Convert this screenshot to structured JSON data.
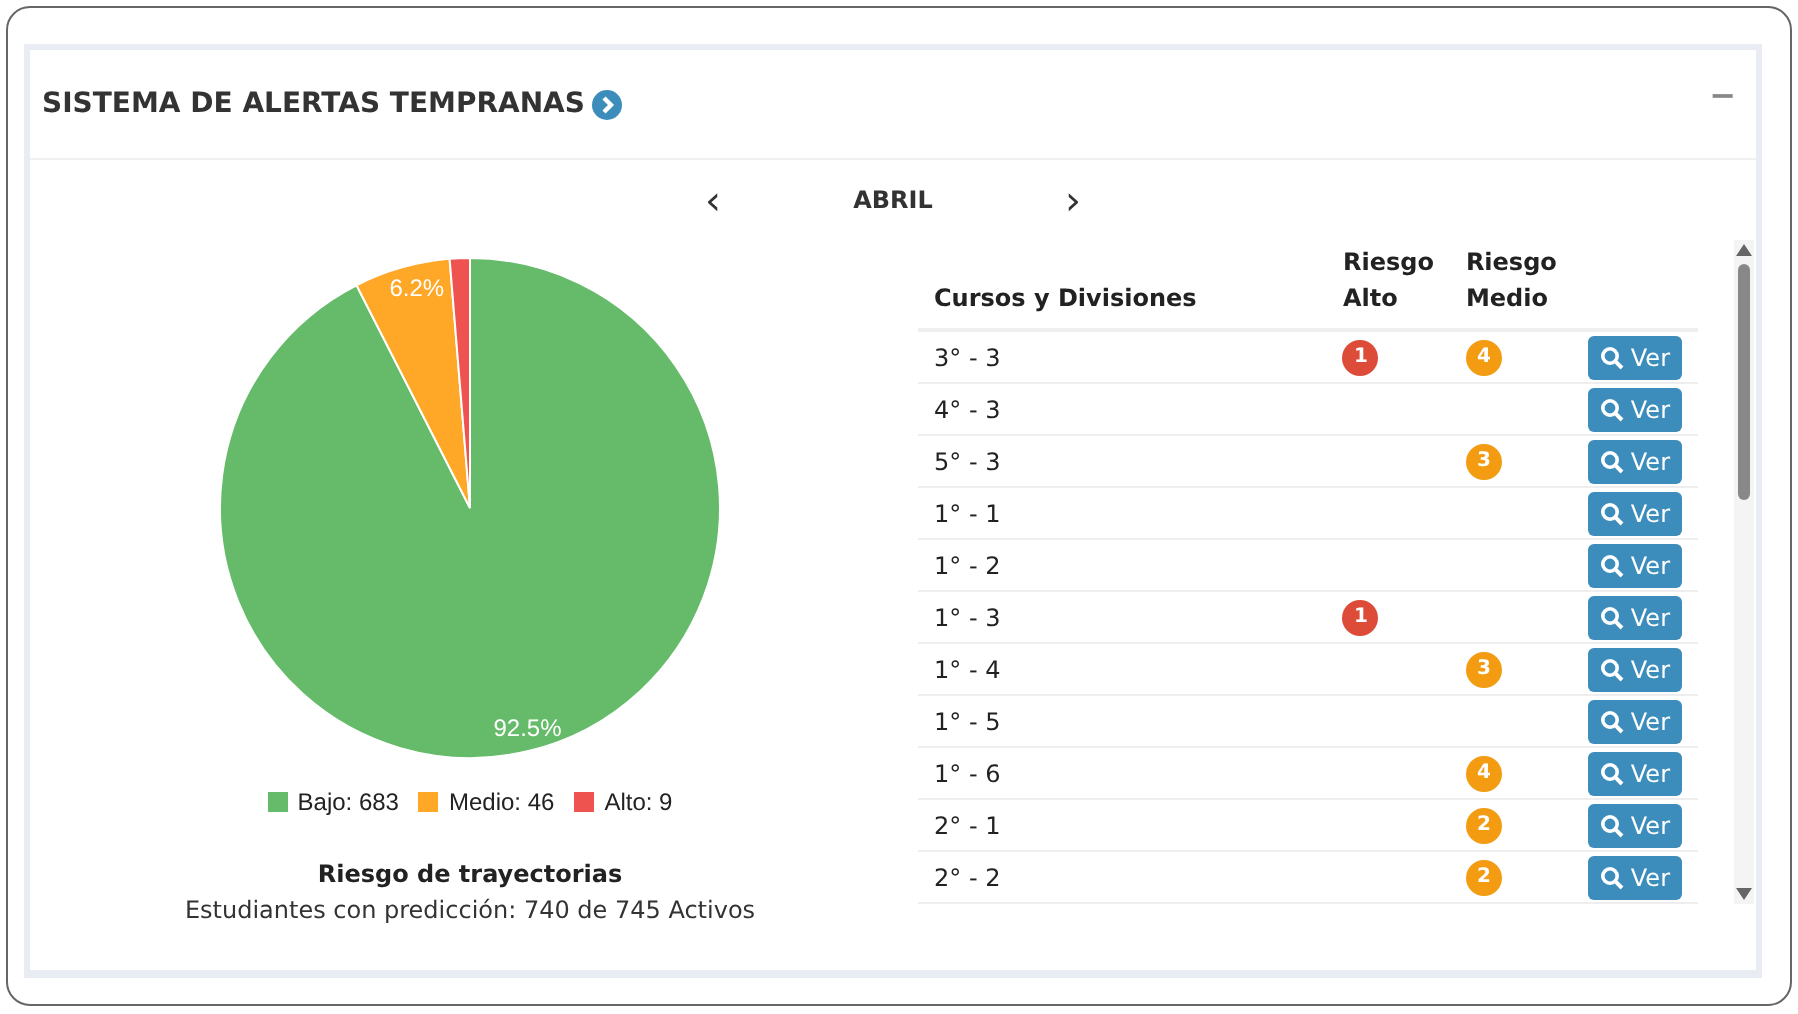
{
  "card": {
    "title": "SISTEMA DE ALERTAS TEMPRANAS",
    "collapse_symbol": "−"
  },
  "month_nav": {
    "prev": "‹",
    "month": "ABRIL",
    "next": "›"
  },
  "chart": {
    "chart_data": {
      "type": "pie",
      "categories": [
        "Bajo: 683",
        "Medio: 46",
        "Alto: 9"
      ],
      "values": [
        92.5,
        6.2,
        1.3
      ],
      "colors": [
        "#66bb6a",
        "#ffa726",
        "#ef5350"
      ],
      "value_labels": [
        "92.5%",
        "6.2%",
        null
      ]
    },
    "caption_title": "Riesgo de trayectorias",
    "caption_text": "Estudiantes con predicción: 740 de 745 Activos"
  },
  "table": {
    "columns": [
      "Cursos y Divisiones",
      "Riesgo Alto",
      "Riesgo Medio"
    ],
    "rows": [
      {
        "course": "3° - 3",
        "high": "1",
        "medium": "4",
        "action": "Ver"
      },
      {
        "course": "4° - 3",
        "action": "Ver"
      },
      {
        "course": "5° - 3",
        "medium": "3",
        "action": "Ver"
      },
      {
        "course": "1° - 1",
        "action": "Ver"
      },
      {
        "course": "1° - 2",
        "action": "Ver"
      },
      {
        "course": "1° - 3",
        "high": "1",
        "action": "Ver"
      },
      {
        "course": "1° - 4",
        "medium": "3",
        "action": "Ver"
      },
      {
        "course": "1° - 5",
        "action": "Ver"
      },
      {
        "course": "1° - 6",
        "medium": "4",
        "action": "Ver"
      },
      {
        "course": "2° - 1",
        "medium": "2",
        "action": "Ver"
      },
      {
        "course": "2° - 2",
        "medium": "2",
        "action": "Ver"
      }
    ]
  }
}
